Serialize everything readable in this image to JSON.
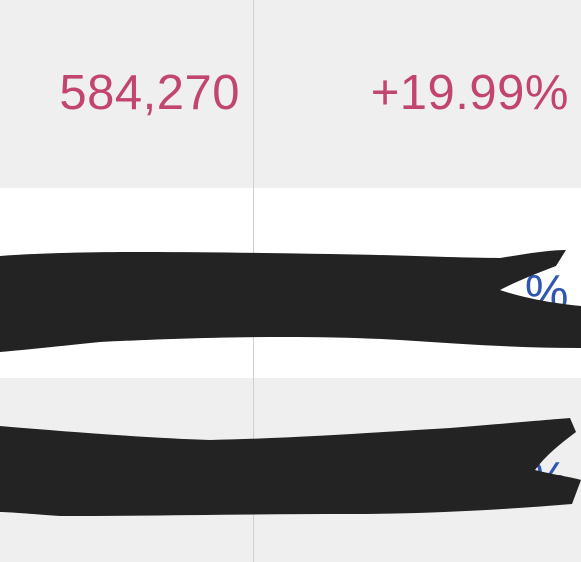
{
  "colors": {
    "positive": "#c2456f",
    "secondary": "#2f56b0",
    "redaction": "#232323"
  },
  "table": {
    "rows": [
      {
        "value": "584,270",
        "change": "+19.99%"
      },
      {
        "value": "",
        "change": "%"
      },
      {
        "value": "",
        "change": "%"
      }
    ]
  }
}
